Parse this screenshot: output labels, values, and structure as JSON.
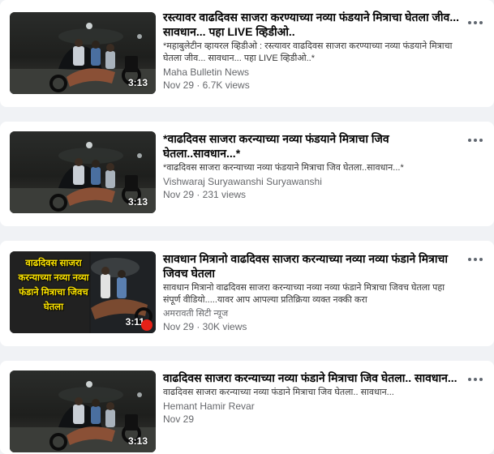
{
  "results": [
    {
      "title": "रस्त्यावर वाढदिवस साजरा करण्याच्या नव्या फंडयाने मित्राचा घेतला जीव... सावधान... पहा LIVE व्हिडीओ..",
      "description": "*महाबुलेटीन व्हायरल व्हिडीओ : रस्त्यावर वाढदिवस साजरा करण्याच्या नव्या फंडयाने मित्राचा घेतला जीव... सावधान... पहा LIVE व्हिडीओ..*",
      "channel": "Maha Bulletin News",
      "meta": "Nov 29 · 6.7K views",
      "duration": "3:13",
      "thumb_overlay": ""
    },
    {
      "title": "*वाढदिवस साजरा करन्याच्या नव्या फंडयाने मित्राचा जिव घेतला..सावधान...*",
      "description": "*वाढदिवस साजरा करन्याच्या नव्या फंडयाने मित्राचा जिव घेतला..सावधान...*",
      "channel": "Vishwaraj Suryawanshi Suryawanshi",
      "meta": "Nov 29 · 231 views",
      "duration": "3:13",
      "thumb_overlay": ""
    },
    {
      "title": "सावधान मित्रानो वाढदिवस साजरा करन्याच्या नव्या नव्या फंडाने मित्राचा जिवच घेतला",
      "description": "सावधान मित्रानो वाढदिवस साजरा करन्याच्या नव्या नव्या फंडाने मित्राचा जिवच घेतला पहा संपूर्ण वीडियो.....यावर आप आपल्या प्रतिक्रिया व्यक्त नक्की करा",
      "channel": "अमरावती सिटी न्यूज",
      "meta": "Nov 29 · 30K views",
      "duration": "3:11",
      "thumb_overlay": "वाढदिवस साजरा करन्याच्या नव्या नव्या फंडाने मित्राचा जिवच घेतला"
    },
    {
      "title": "वाढदिवस साजरा करन्याच्या नव्या फंडाने मित्राचा जिव घेतला.. सावधान...",
      "description": "वाढदिवस साजरा करन्याच्या नव्या फंडाने मित्राचा जिव घेतला.. सावधान...",
      "channel": "Hemant Hamir Revar",
      "meta": "Nov 29",
      "duration": "3:13",
      "thumb_overlay": ""
    }
  ],
  "icons": {
    "more": "more-options-icon",
    "video_source_badge": "youtube-badge-icon"
  },
  "colors": {
    "background": "#f0f2f5",
    "card": "#ffffff",
    "secondary_text": "#65676b",
    "overlay_text": "#ffe600"
  }
}
